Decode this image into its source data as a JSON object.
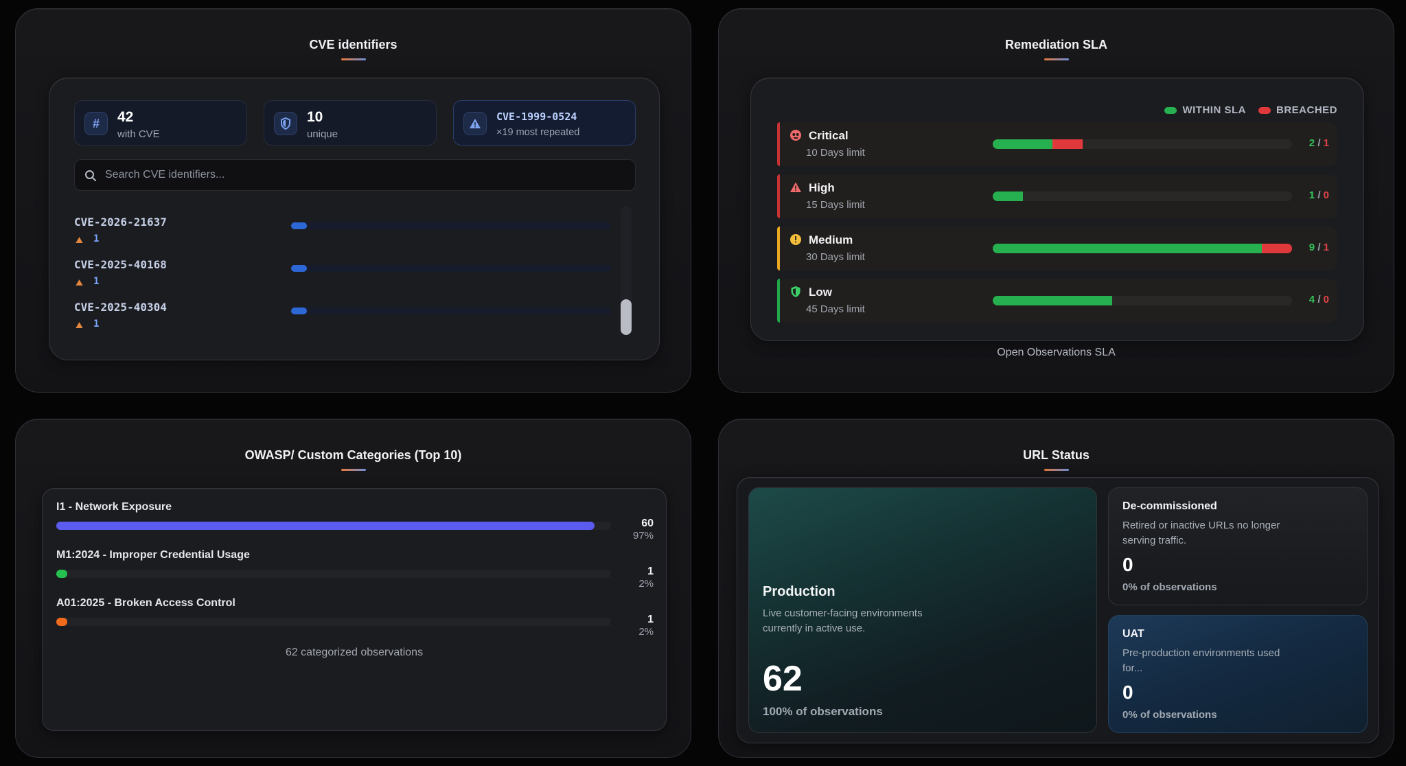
{
  "colors": {
    "accent_blue": "#2d67d6",
    "within_sla": "#26b04f",
    "breached": "#e0393b",
    "critical": "#e0393b",
    "high": "#e0393b",
    "medium": "#f0b429",
    "low": "#26b04f",
    "owasp_bar_1": "#5b5bf0",
    "owasp_bar_2": "#26c24f",
    "owasp_bar_3": "#f26a1b"
  },
  "cve": {
    "title": "CVE identifiers",
    "stats": [
      {
        "icon": "hash-icon",
        "value": "42",
        "label": "with CVE"
      },
      {
        "icon": "shield-icon",
        "value": "10",
        "label": "unique"
      },
      {
        "icon": "warning-triangle-icon",
        "value": "CVE-1999-0524",
        "label": "×19 most repeated"
      }
    ],
    "search": {
      "placeholder": "Search CVE identifiers..."
    },
    "rows": [
      {
        "id": "CVE-2026-21637",
        "count": "1",
        "fraction": 0.05
      },
      {
        "id": "CVE-2025-40168",
        "count": "1",
        "fraction": 0.05
      },
      {
        "id": "CVE-2025-40304",
        "count": "1",
        "fraction": 0.05
      }
    ]
  },
  "sla": {
    "title": "Remediation SLA",
    "legend": {
      "within": "WITHIN SLA",
      "breached": "BREACHED"
    },
    "rows": [
      {
        "name": "Critical",
        "limit": "10 Days limit",
        "within": 2,
        "breached": 1,
        "within_text": "2",
        "breached_text": "1",
        "icon": "skull-icon",
        "color": "#e0393b"
      },
      {
        "name": "High",
        "limit": "15 Days limit",
        "within": 1,
        "breached": 0,
        "within_text": "1",
        "breached_text": "0",
        "icon": "warning-triangle-icon",
        "color": "#e0393b"
      },
      {
        "name": "Medium",
        "limit": "30 Days limit",
        "within": 9,
        "breached": 1,
        "within_text": "9",
        "breached_text": "1",
        "icon": "info-circle-icon",
        "color": "#f0b429"
      },
      {
        "name": "Low",
        "limit": "45 Days limit",
        "within": 4,
        "breached": 0,
        "within_text": "4",
        "breached_text": "0",
        "icon": "shield-icon",
        "color": "#26b04f"
      }
    ],
    "scale_max": 10,
    "separator": "/",
    "caption": "Open Observations SLA"
  },
  "owasp": {
    "title": "OWASP/ Custom Categories (Top 10)",
    "rows": [
      {
        "label": "I1 - Network Exposure",
        "count": "60",
        "pct": "97%",
        "fraction": 0.97,
        "color": "#5b5bf0"
      },
      {
        "label": "M1:2024 - Improper Credential Usage",
        "count": "1",
        "pct": "2%",
        "fraction": 0.02,
        "color": "#26c24f"
      },
      {
        "label": "A01:2025 - Broken Access Control",
        "count": "1",
        "pct": "2%",
        "fraction": 0.02,
        "color": "#f26a1b"
      }
    ],
    "caption": "62 categorized observations"
  },
  "url": {
    "title": "URL Status",
    "production": {
      "title": "Production",
      "desc": "Live customer-facing environments currently in active use.",
      "value": "62",
      "pct": "100% of observations"
    },
    "decommissioned": {
      "title": "De-commissioned",
      "desc": "Retired or inactive URLs no longer serving traffic.",
      "value": "0",
      "pct": "0% of observations"
    },
    "uat": {
      "title": "UAT",
      "desc": "Pre-production environments used for...",
      "value": "0",
      "pct": "0% of observations"
    }
  }
}
